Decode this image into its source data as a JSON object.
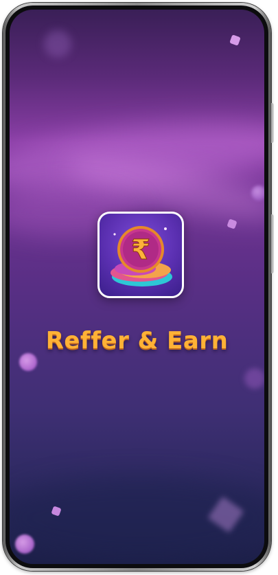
{
  "splash": {
    "app_name": "Reffer & Earn",
    "logo_symbol": "₹",
    "logo_icon": "rupee-coin-icon"
  },
  "colors": {
    "title": "#ffb236",
    "background_top": "#5a2a78",
    "background_bottom": "#1c1f48",
    "icon_border": "#ffffff"
  }
}
